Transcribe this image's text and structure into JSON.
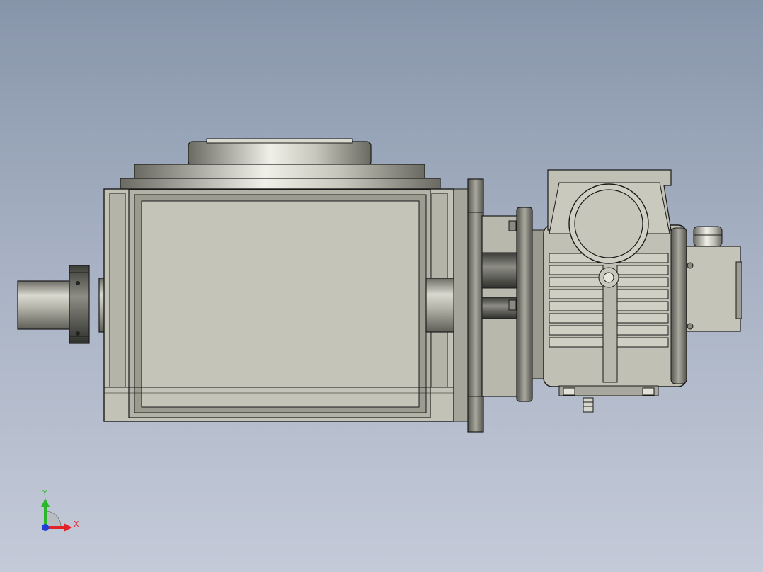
{
  "viewport": {
    "background_top": "#8795aa",
    "background_bottom": "#c4cad8"
  },
  "model": {
    "part_color": "#c2c2b6",
    "edge_color": "#1a1a1a",
    "components": [
      "output-shaft",
      "shaft-collar",
      "indexer-housing",
      "top-turntable",
      "right-shaft-stub",
      "mounting-flange",
      "adapter-housing",
      "motor-flange",
      "motor-body",
      "terminal-box",
      "encoder-cap",
      "cable-gland"
    ]
  },
  "triad": {
    "x_label": "X",
    "y_label": "Y",
    "x_color": "#e0242a",
    "y_color": "#2bb72b",
    "z_color": "#1f3fd6"
  }
}
